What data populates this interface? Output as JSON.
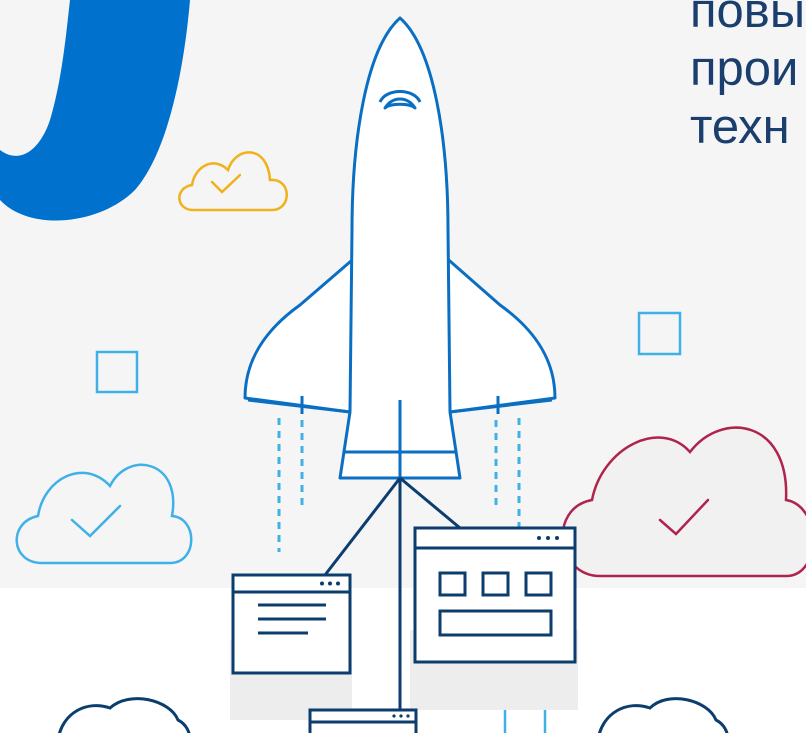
{
  "headline": {
    "line1": "повы",
    "line2": "прои",
    "line3": "техн"
  },
  "colors": {
    "background": "#f5f5f6",
    "brand_blue": "#0072ce",
    "rocket_stroke": "#0a6fc2",
    "navy": "#0b3d6e",
    "light_blue": "#3fb1e6",
    "gold": "#f1b11a",
    "crimson": "#b0244c"
  },
  "icons": {
    "big_glyph": "letter-shape",
    "rocket": "space-shuttle-icon",
    "clouds": [
      "cloud-check-icon"
    ],
    "windows": [
      "browser-window-icon"
    ]
  }
}
